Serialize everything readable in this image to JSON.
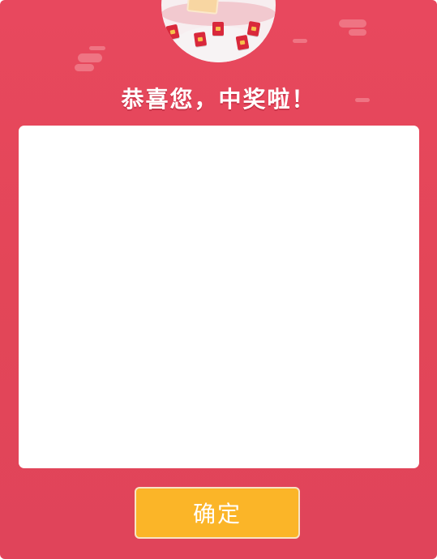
{
  "dialog": {
    "title": "恭喜您，中奖啦！",
    "confirm_label": "确定",
    "content": ""
  },
  "colors": {
    "background": "#e4465a",
    "decor": "#f07c8a",
    "content_bg": "#ffffff",
    "button": "#fbb528",
    "button_border": "#f8e3c5",
    "title_text": "#ffffff"
  },
  "icons": {
    "badge": "red-envelope-illustration-icon"
  }
}
